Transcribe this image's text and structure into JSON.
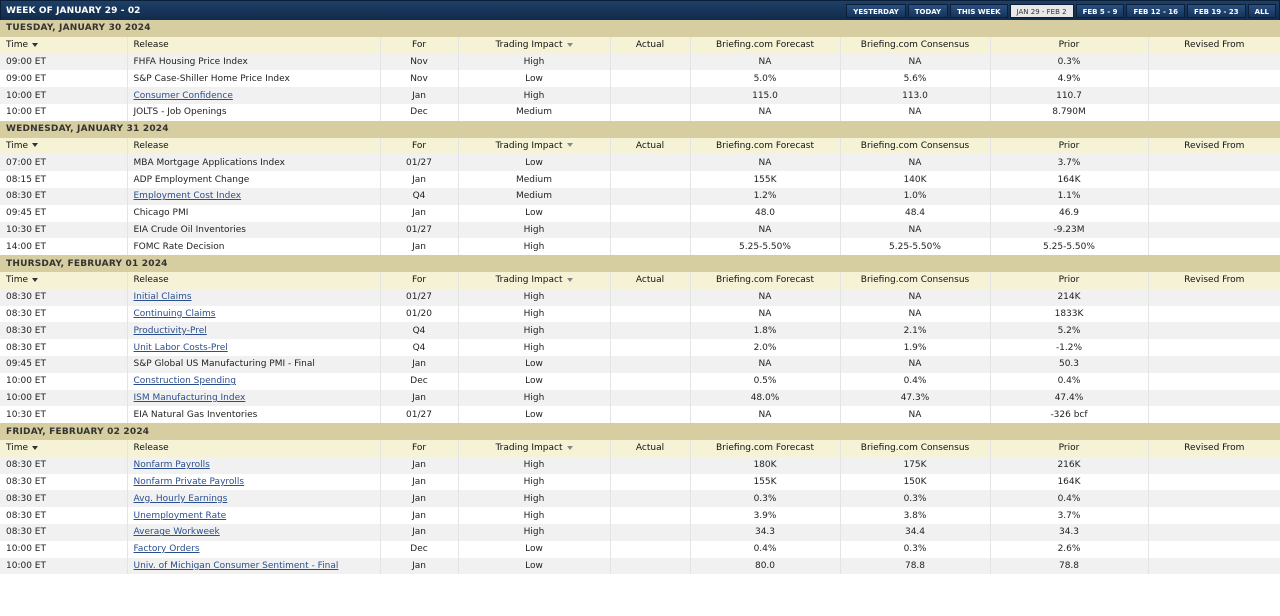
{
  "week_title": "WEEK OF JANUARY 29 - 02",
  "tabs": [
    {
      "label": "YESTERDAY",
      "active": false
    },
    {
      "label": "TODAY",
      "active": false
    },
    {
      "label": "THIS WEEK",
      "active": false
    },
    {
      "label": "JAN 29 - FEB 2",
      "active": true
    },
    {
      "label": "FEB 5 - 9",
      "active": false
    },
    {
      "label": "FEB 12 - 16",
      "active": false
    },
    {
      "label": "FEB 19 - 23",
      "active": false
    },
    {
      "label": "ALL",
      "active": false
    }
  ],
  "columns": {
    "time": "Time",
    "release": "Release",
    "for": "For",
    "impact": "Trading Impact",
    "actual": "Actual",
    "forecast": "Briefing.com Forecast",
    "consensus": "Briefing.com Consensus",
    "prior": "Prior",
    "revised": "Revised From"
  },
  "days": [
    {
      "label": "TUESDAY, JANUARY 30 2024",
      "rows": [
        {
          "time": "09:00 ET",
          "release": "FHFA Housing Price Index",
          "link": false,
          "for": "Nov",
          "impact": "High",
          "actual": "",
          "forecast": "NA",
          "consensus": "NA",
          "prior": "0.3%",
          "revised": ""
        },
        {
          "time": "09:00 ET",
          "release": "S&P Case-Shiller Home Price Index",
          "link": false,
          "for": "Nov",
          "impact": "Low",
          "actual": "",
          "forecast": "5.0%",
          "consensus": "5.6%",
          "prior": "4.9%",
          "revised": ""
        },
        {
          "time": "10:00 ET",
          "release": "Consumer Confidence",
          "link": true,
          "for": "Jan",
          "impact": "High",
          "actual": "",
          "forecast": "115.0",
          "consensus": "113.0",
          "prior": "110.7",
          "revised": ""
        },
        {
          "time": "10:00 ET",
          "release": "JOLTS - Job Openings",
          "link": false,
          "for": "Dec",
          "impact": "Medium",
          "actual": "",
          "forecast": "NA",
          "consensus": "NA",
          "prior": "8.790M",
          "revised": ""
        }
      ]
    },
    {
      "label": "WEDNESDAY, JANUARY 31 2024",
      "rows": [
        {
          "time": "07:00 ET",
          "release": "MBA Mortgage Applications Index",
          "link": false,
          "for": "01/27",
          "impact": "Low",
          "actual": "",
          "forecast": "NA",
          "consensus": "NA",
          "prior": "3.7%",
          "revised": ""
        },
        {
          "time": "08:15 ET",
          "release": "ADP Employment Change",
          "link": false,
          "for": "Jan",
          "impact": "Medium",
          "actual": "",
          "forecast": "155K",
          "consensus": "140K",
          "prior": "164K",
          "revised": ""
        },
        {
          "time": "08:30 ET",
          "release": "Employment Cost Index",
          "link": true,
          "for": "Q4",
          "impact": "Medium",
          "actual": "",
          "forecast": "1.2%",
          "consensus": "1.0%",
          "prior": "1.1%",
          "revised": ""
        },
        {
          "time": "09:45 ET",
          "release": "Chicago PMI",
          "link": false,
          "for": "Jan",
          "impact": "Low",
          "actual": "",
          "forecast": "48.0",
          "consensus": "48.4",
          "prior": "46.9",
          "revised": ""
        },
        {
          "time": "10:30 ET",
          "release": "EIA Crude Oil Inventories",
          "link": false,
          "for": "01/27",
          "impact": "High",
          "actual": "",
          "forecast": "NA",
          "consensus": "NA",
          "prior": "-9.23M",
          "revised": ""
        },
        {
          "time": "14:00 ET",
          "release": "FOMC Rate Decision",
          "link": false,
          "for": "Jan",
          "impact": "High",
          "actual": "",
          "forecast": "5.25-5.50%",
          "consensus": "5.25-5.50%",
          "prior": "5.25-5.50%",
          "revised": ""
        }
      ]
    },
    {
      "label": "THURSDAY, FEBRUARY 01 2024",
      "rows": [
        {
          "time": "08:30 ET",
          "release": "Initial Claims",
          "link": true,
          "for": "01/27",
          "impact": "High",
          "actual": "",
          "forecast": "NA",
          "consensus": "NA",
          "prior": "214K",
          "revised": ""
        },
        {
          "time": "08:30 ET",
          "release": "Continuing Claims",
          "link": true,
          "for": "01/20",
          "impact": "High",
          "actual": "",
          "forecast": "NA",
          "consensus": "NA",
          "prior": "1833K",
          "revised": ""
        },
        {
          "time": "08:30 ET",
          "release": "Productivity-Prel",
          "link": true,
          "for": "Q4",
          "impact": "High",
          "actual": "",
          "forecast": "1.8%",
          "consensus": "2.1%",
          "prior": "5.2%",
          "revised": ""
        },
        {
          "time": "08:30 ET",
          "release": "Unit Labor Costs-Prel",
          "link": true,
          "for": "Q4",
          "impact": "High",
          "actual": "",
          "forecast": "2.0%",
          "consensus": "1.9%",
          "prior": "-1.2%",
          "revised": ""
        },
        {
          "time": "09:45 ET",
          "release": "S&P Global US Manufacturing PMI - Final",
          "link": false,
          "for": "Jan",
          "impact": "Low",
          "actual": "",
          "forecast": "NA",
          "consensus": "NA",
          "prior": "50.3",
          "revised": ""
        },
        {
          "time": "10:00 ET",
          "release": "Construction Spending",
          "link": true,
          "for": "Dec",
          "impact": "Low",
          "actual": "",
          "forecast": "0.5%",
          "consensus": "0.4%",
          "prior": "0.4%",
          "revised": ""
        },
        {
          "time": "10:00 ET",
          "release": "ISM Manufacturing Index",
          "link": true,
          "for": "Jan",
          "impact": "High",
          "actual": "",
          "forecast": "48.0%",
          "consensus": "47.3%",
          "prior": "47.4%",
          "revised": ""
        },
        {
          "time": "10:30 ET",
          "release": "EIA Natural Gas Inventories",
          "link": false,
          "for": "01/27",
          "impact": "Low",
          "actual": "",
          "forecast": "NA",
          "consensus": "NA",
          "prior": "-326 bcf",
          "revised": ""
        }
      ]
    },
    {
      "label": "FRIDAY, FEBRUARY 02 2024",
      "rows": [
        {
          "time": "08:30 ET",
          "release": "Nonfarm Payrolls",
          "link": true,
          "for": "Jan",
          "impact": "High",
          "actual": "",
          "forecast": "180K",
          "consensus": "175K",
          "prior": "216K",
          "revised": ""
        },
        {
          "time": "08:30 ET",
          "release": "Nonfarm Private Payrolls",
          "link": true,
          "for": "Jan",
          "impact": "High",
          "actual": "",
          "forecast": "155K",
          "consensus": "150K",
          "prior": "164K",
          "revised": ""
        },
        {
          "time": "08:30 ET",
          "release": "Avg. Hourly Earnings",
          "link": true,
          "for": "Jan",
          "impact": "High",
          "actual": "",
          "forecast": "0.3%",
          "consensus": "0.3%",
          "prior": "0.4%",
          "revised": ""
        },
        {
          "time": "08:30 ET",
          "release": "Unemployment Rate",
          "link": true,
          "for": "Jan",
          "impact": "High",
          "actual": "",
          "forecast": "3.9%",
          "consensus": "3.8%",
          "prior": "3.7%",
          "revised": ""
        },
        {
          "time": "08:30 ET",
          "release": "Average Workweek",
          "link": true,
          "for": "Jan",
          "impact": "High",
          "actual": "",
          "forecast": "34.3",
          "consensus": "34.4",
          "prior": "34.3",
          "revised": ""
        },
        {
          "time": "10:00 ET",
          "release": "Factory Orders",
          "link": true,
          "for": "Dec",
          "impact": "Low",
          "actual": "",
          "forecast": "0.4%",
          "consensus": "0.3%",
          "prior": "2.6%",
          "revised": ""
        },
        {
          "time": "10:00 ET",
          "release": "Univ. of Michigan Consumer Sentiment - Final",
          "link": true,
          "for": "Jan",
          "impact": "Low",
          "actual": "",
          "forecast": "80.0",
          "consensus": "78.8",
          "prior": "78.8",
          "revised": ""
        }
      ]
    }
  ]
}
